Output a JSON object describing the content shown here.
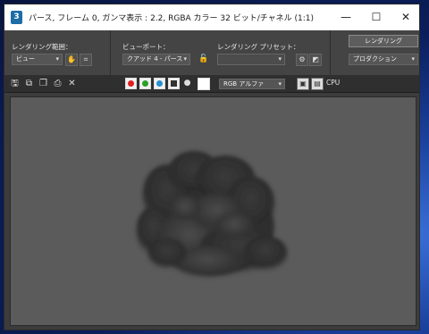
{
  "window": {
    "title": "パース, フレーム 0, ガンマ表示 : 2.2, RGBA カラー 32 ビット/チャネル (1:1)",
    "app_icon_glyph": "3"
  },
  "titlebar_buttons": {
    "minimize": "—",
    "maximize": "☐",
    "close": "✕"
  },
  "controls": {
    "render_area_label": "レンダリング範囲：",
    "render_area_value": "ビュー",
    "viewport_label": "ビューポート：",
    "viewport_value": "クアッド 4 - パース",
    "preset_label": "レンダリング プリセット：",
    "preset_value": "",
    "render_button": "レンダリング",
    "production_value": "プロダクション"
  },
  "toolbar": {
    "channel_value": "RGB アルファ",
    "cpu_label": "CPU",
    "channels": [
      {
        "name": "red",
        "color": "#e02020"
      },
      {
        "name": "green",
        "color": "#2aa02a"
      },
      {
        "name": "blue",
        "color": "#2a8fd0"
      }
    ]
  },
  "icons": {
    "save": "save-icon",
    "copy": "copy-icon",
    "clone": "clone-icon",
    "print": "print-icon",
    "clear": "clear-icon"
  }
}
